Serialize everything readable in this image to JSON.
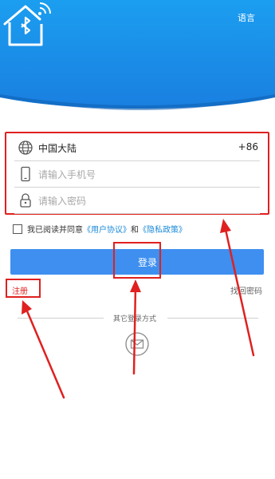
{
  "header": {
    "language_label": "语言"
  },
  "form": {
    "region_label": "中国大陆",
    "country_code": "+86",
    "phone_placeholder": "请输入手机号",
    "password_placeholder": "请输入密码"
  },
  "agreement": {
    "prefix": "我已阅读并同意",
    "user_agreement": "《用户协议》",
    "and": "和",
    "privacy_policy": "《隐私政策》"
  },
  "buttons": {
    "login": "登录",
    "register": "注册",
    "forgot_password": "找回密码"
  },
  "other_login": {
    "label": "其它登录方式"
  },
  "colors": {
    "brand_blue": "#3e8ff0",
    "header_blue": "#1f8fe6",
    "annotation_red": "#e02020"
  }
}
